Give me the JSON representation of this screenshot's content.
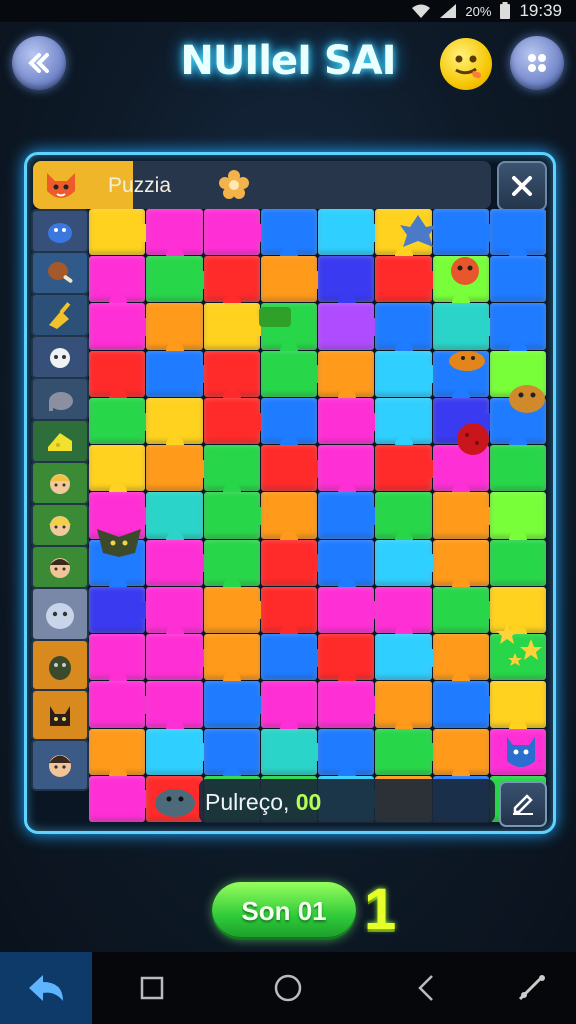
{
  "status_bar": {
    "battery_text": "20%",
    "time": "19:39"
  },
  "header": {
    "title": "NUIleI SAI"
  },
  "panel": {
    "header_label": "Puzzia",
    "bottom_label": "Pulreço,",
    "bottom_value": "00"
  },
  "score_button": {
    "label": "Son 01"
  },
  "score_number": "1",
  "icons": {
    "back": "back-icon",
    "menu": "dots-icon",
    "emoji": "emoji-icon",
    "close": "close-icon",
    "edit": "edit-icon",
    "flower": "flower-icon"
  },
  "colors": {
    "accent_glow": "#5fd3ff",
    "score_green": "#2ec93a",
    "score_yellow": "#e6ff2a",
    "panel_header": "#f0b62a"
  }
}
